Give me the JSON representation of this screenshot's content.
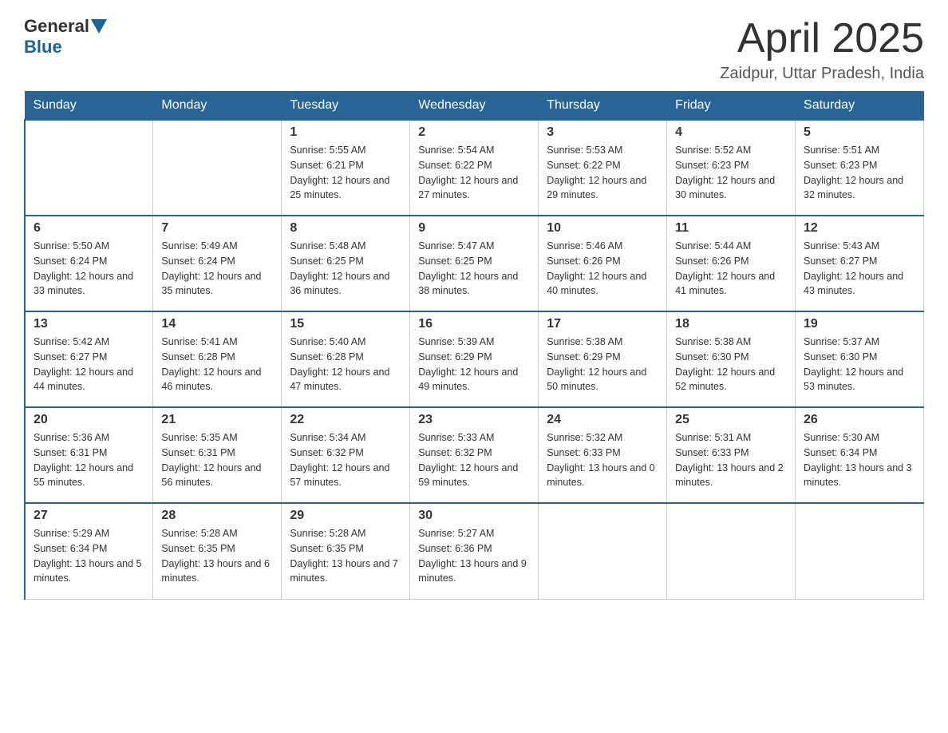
{
  "header": {
    "logo_general": "General",
    "logo_blue": "Blue",
    "month_title": "April 2025",
    "location": "Zaidpur, Uttar Pradesh, India"
  },
  "weekdays": [
    "Sunday",
    "Monday",
    "Tuesday",
    "Wednesday",
    "Thursday",
    "Friday",
    "Saturday"
  ],
  "weeks": [
    [
      {
        "day": "",
        "sunrise": "",
        "sunset": "",
        "daylight": ""
      },
      {
        "day": "",
        "sunrise": "",
        "sunset": "",
        "daylight": ""
      },
      {
        "day": "1",
        "sunrise": "Sunrise: 5:55 AM",
        "sunset": "Sunset: 6:21 PM",
        "daylight": "Daylight: 12 hours and 25 minutes."
      },
      {
        "day": "2",
        "sunrise": "Sunrise: 5:54 AM",
        "sunset": "Sunset: 6:22 PM",
        "daylight": "Daylight: 12 hours and 27 minutes."
      },
      {
        "day": "3",
        "sunrise": "Sunrise: 5:53 AM",
        "sunset": "Sunset: 6:22 PM",
        "daylight": "Daylight: 12 hours and 29 minutes."
      },
      {
        "day": "4",
        "sunrise": "Sunrise: 5:52 AM",
        "sunset": "Sunset: 6:23 PM",
        "daylight": "Daylight: 12 hours and 30 minutes."
      },
      {
        "day": "5",
        "sunrise": "Sunrise: 5:51 AM",
        "sunset": "Sunset: 6:23 PM",
        "daylight": "Daylight: 12 hours and 32 minutes."
      }
    ],
    [
      {
        "day": "6",
        "sunrise": "Sunrise: 5:50 AM",
        "sunset": "Sunset: 6:24 PM",
        "daylight": "Daylight: 12 hours and 33 minutes."
      },
      {
        "day": "7",
        "sunrise": "Sunrise: 5:49 AM",
        "sunset": "Sunset: 6:24 PM",
        "daylight": "Daylight: 12 hours and 35 minutes."
      },
      {
        "day": "8",
        "sunrise": "Sunrise: 5:48 AM",
        "sunset": "Sunset: 6:25 PM",
        "daylight": "Daylight: 12 hours and 36 minutes."
      },
      {
        "day": "9",
        "sunrise": "Sunrise: 5:47 AM",
        "sunset": "Sunset: 6:25 PM",
        "daylight": "Daylight: 12 hours and 38 minutes."
      },
      {
        "day": "10",
        "sunrise": "Sunrise: 5:46 AM",
        "sunset": "Sunset: 6:26 PM",
        "daylight": "Daylight: 12 hours and 40 minutes."
      },
      {
        "day": "11",
        "sunrise": "Sunrise: 5:44 AM",
        "sunset": "Sunset: 6:26 PM",
        "daylight": "Daylight: 12 hours and 41 minutes."
      },
      {
        "day": "12",
        "sunrise": "Sunrise: 5:43 AM",
        "sunset": "Sunset: 6:27 PM",
        "daylight": "Daylight: 12 hours and 43 minutes."
      }
    ],
    [
      {
        "day": "13",
        "sunrise": "Sunrise: 5:42 AM",
        "sunset": "Sunset: 6:27 PM",
        "daylight": "Daylight: 12 hours and 44 minutes."
      },
      {
        "day": "14",
        "sunrise": "Sunrise: 5:41 AM",
        "sunset": "Sunset: 6:28 PM",
        "daylight": "Daylight: 12 hours and 46 minutes."
      },
      {
        "day": "15",
        "sunrise": "Sunrise: 5:40 AM",
        "sunset": "Sunset: 6:28 PM",
        "daylight": "Daylight: 12 hours and 47 minutes."
      },
      {
        "day": "16",
        "sunrise": "Sunrise: 5:39 AM",
        "sunset": "Sunset: 6:29 PM",
        "daylight": "Daylight: 12 hours and 49 minutes."
      },
      {
        "day": "17",
        "sunrise": "Sunrise: 5:38 AM",
        "sunset": "Sunset: 6:29 PM",
        "daylight": "Daylight: 12 hours and 50 minutes."
      },
      {
        "day": "18",
        "sunrise": "Sunrise: 5:38 AM",
        "sunset": "Sunset: 6:30 PM",
        "daylight": "Daylight: 12 hours and 52 minutes."
      },
      {
        "day": "19",
        "sunrise": "Sunrise: 5:37 AM",
        "sunset": "Sunset: 6:30 PM",
        "daylight": "Daylight: 12 hours and 53 minutes."
      }
    ],
    [
      {
        "day": "20",
        "sunrise": "Sunrise: 5:36 AM",
        "sunset": "Sunset: 6:31 PM",
        "daylight": "Daylight: 12 hours and 55 minutes."
      },
      {
        "day": "21",
        "sunrise": "Sunrise: 5:35 AM",
        "sunset": "Sunset: 6:31 PM",
        "daylight": "Daylight: 12 hours and 56 minutes."
      },
      {
        "day": "22",
        "sunrise": "Sunrise: 5:34 AM",
        "sunset": "Sunset: 6:32 PM",
        "daylight": "Daylight: 12 hours and 57 minutes."
      },
      {
        "day": "23",
        "sunrise": "Sunrise: 5:33 AM",
        "sunset": "Sunset: 6:32 PM",
        "daylight": "Daylight: 12 hours and 59 minutes."
      },
      {
        "day": "24",
        "sunrise": "Sunrise: 5:32 AM",
        "sunset": "Sunset: 6:33 PM",
        "daylight": "Daylight: 13 hours and 0 minutes."
      },
      {
        "day": "25",
        "sunrise": "Sunrise: 5:31 AM",
        "sunset": "Sunset: 6:33 PM",
        "daylight": "Daylight: 13 hours and 2 minutes."
      },
      {
        "day": "26",
        "sunrise": "Sunrise: 5:30 AM",
        "sunset": "Sunset: 6:34 PM",
        "daylight": "Daylight: 13 hours and 3 minutes."
      }
    ],
    [
      {
        "day": "27",
        "sunrise": "Sunrise: 5:29 AM",
        "sunset": "Sunset: 6:34 PM",
        "daylight": "Daylight: 13 hours and 5 minutes."
      },
      {
        "day": "28",
        "sunrise": "Sunrise: 5:28 AM",
        "sunset": "Sunset: 6:35 PM",
        "daylight": "Daylight: 13 hours and 6 minutes."
      },
      {
        "day": "29",
        "sunrise": "Sunrise: 5:28 AM",
        "sunset": "Sunset: 6:35 PM",
        "daylight": "Daylight: 13 hours and 7 minutes."
      },
      {
        "day": "30",
        "sunrise": "Sunrise: 5:27 AM",
        "sunset": "Sunset: 6:36 PM",
        "daylight": "Daylight: 13 hours and 9 minutes."
      },
      {
        "day": "",
        "sunrise": "",
        "sunset": "",
        "daylight": ""
      },
      {
        "day": "",
        "sunrise": "",
        "sunset": "",
        "daylight": ""
      },
      {
        "day": "",
        "sunrise": "",
        "sunset": "",
        "daylight": ""
      }
    ]
  ]
}
